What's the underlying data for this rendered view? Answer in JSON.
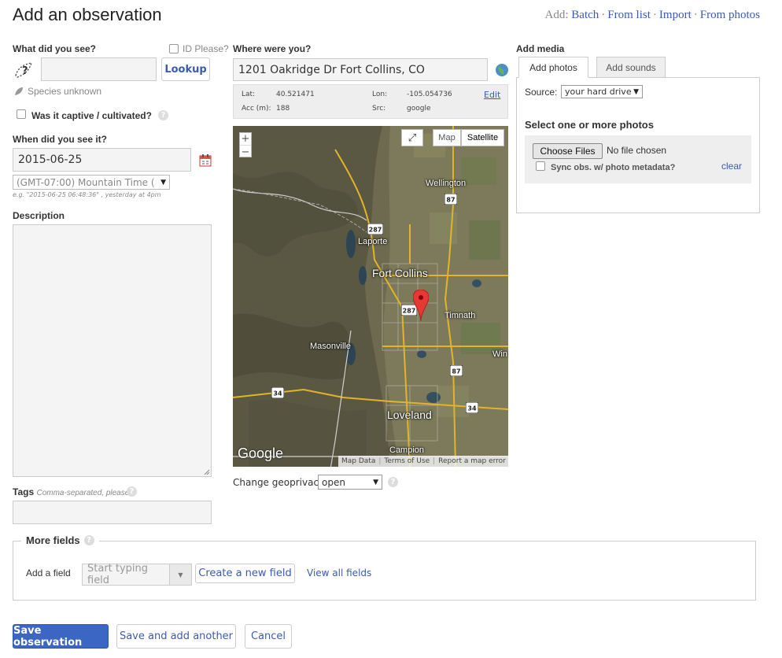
{
  "header": {
    "title": "Add an observation",
    "add_prefix": "Add:",
    "links": [
      "Batch",
      "From list",
      "Import",
      "From photos"
    ],
    "separator": "·"
  },
  "what": {
    "label": "What did you see?",
    "id_please": "ID Please?",
    "species_value": "",
    "lookup_button": "Lookup",
    "species_status": "Species unknown",
    "captive_label": "Was it captive / cultivated?",
    "help": "?"
  },
  "when": {
    "label": "When did you see it?",
    "date_value": "2015-06-25",
    "timezone": "(GMT-07:00) Mountain Time (",
    "hint": "e.g. \"2015-06-25 06:48:36\" , yesterday at 4pm"
  },
  "description": {
    "label": "Description",
    "value": ""
  },
  "tags": {
    "label": "Tags",
    "hint": "Comma-separated, please",
    "value": ""
  },
  "where": {
    "label": "Where were you?",
    "address": "1201 Oakridge Dr Fort Collins, CO",
    "lat_label": "Lat:",
    "lat": "40.521471",
    "lon_label": "Lon:",
    "lon": "-105.054736",
    "acc_label": "Acc (m):",
    "acc": "188",
    "src_label": "Src:",
    "src": "google",
    "edit": "Edit"
  },
  "map": {
    "zoom_in": "+",
    "zoom_out": "−",
    "map_button": "Map",
    "satellite_button": "Satellite",
    "fullscreen": "⤢",
    "logo": "Google",
    "places": {
      "wellington": "Wellington",
      "laporte": "Laporte",
      "fort_collins": "Fort Collins",
      "timnath": "Timnath",
      "masonville": "Masonville",
      "loveland": "Loveland",
      "campion": "Campion",
      "win": "Win"
    },
    "shields": {
      "us87_north": "87",
      "us287_north": "287",
      "us287_city": "287",
      "us87_south": "87",
      "sh34_west": "34",
      "sh34_east": "34"
    },
    "attribution": {
      "map_data": "Map Data",
      "terms": "Terms of Use",
      "report": "Report a map error"
    }
  },
  "geoprivacy": {
    "label": "Change geoprivacy",
    "value": "open"
  },
  "media": {
    "label": "Add media",
    "tabs": [
      "Add photos",
      "Add sounds"
    ],
    "source_label": "Source:",
    "source_value": "your hard drive",
    "select_title": "Select one or more photos",
    "choose_files": "Choose Files",
    "no_file": "No file chosen",
    "sync_label": "Sync obs. w/ photo metadata?",
    "clear": "clear"
  },
  "more_fields": {
    "legend": "More fields",
    "add_field_label": "Add a field",
    "placeholder": "Start typing field",
    "create_button": "Create a new field",
    "view_all": "View all fields"
  },
  "actions": {
    "save": "Save observation",
    "save_add": "Save and add another",
    "cancel": "Cancel"
  },
  "colors": {
    "link": "#3b5bb2",
    "primary": "#3b66c4",
    "pin": "#e53935"
  }
}
